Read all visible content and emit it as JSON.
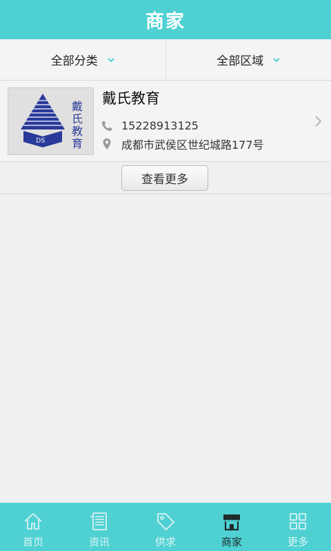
{
  "header": {
    "title": "商家"
  },
  "filters": [
    {
      "label": "全部分类"
    },
    {
      "label": "全部区域"
    }
  ],
  "merchant": {
    "name": "戴氏教育",
    "phone": "15228913125",
    "address": "成都市武侯区世纪城路177号",
    "logo_text": "戴氏教育",
    "logo_caption": "DS"
  },
  "more_button": {
    "label": "查看更多"
  },
  "tabs": [
    {
      "label": "首页",
      "icon": "home-icon",
      "active": false
    },
    {
      "label": "资讯",
      "icon": "news-icon",
      "active": false
    },
    {
      "label": "供求",
      "icon": "tag-icon",
      "active": false
    },
    {
      "label": "商家",
      "icon": "store-icon",
      "active": true
    },
    {
      "label": "更多",
      "icon": "grid-icon",
      "active": false
    }
  ],
  "colors": {
    "accent": "#4fd1d3",
    "background": "#f0f0f0",
    "logo_blue": "#2a3a9a"
  }
}
